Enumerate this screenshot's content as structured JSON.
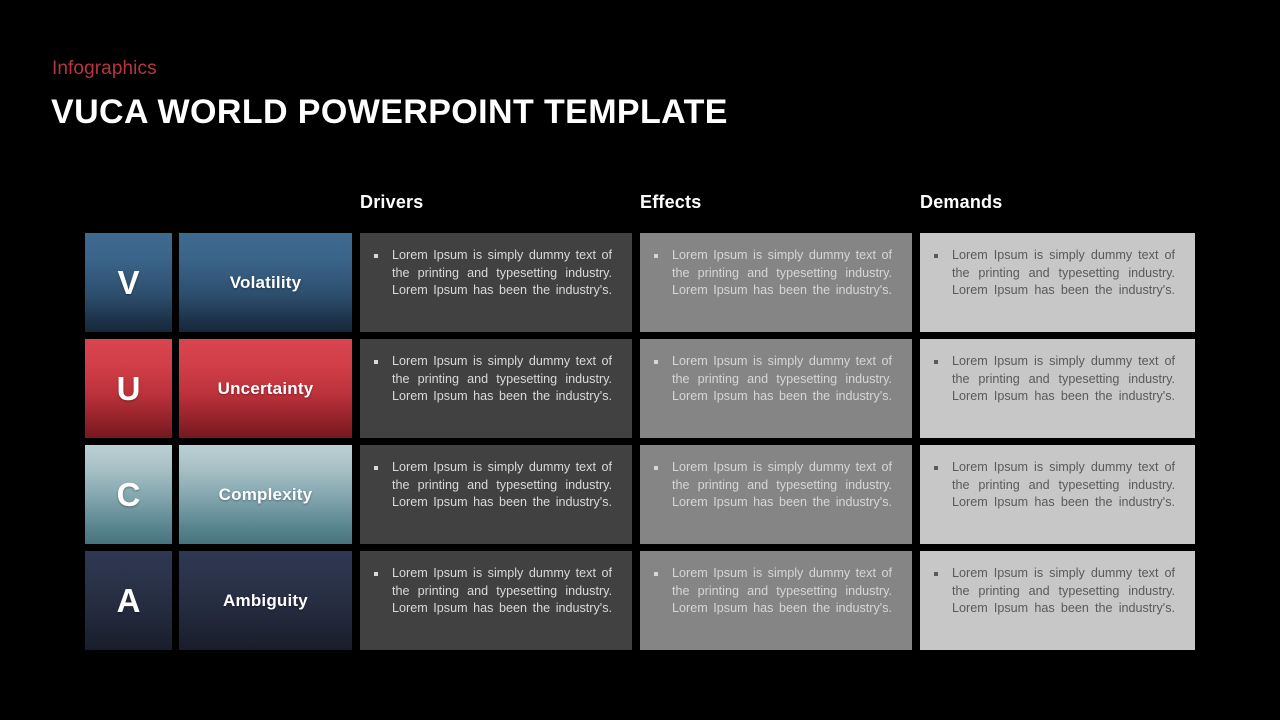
{
  "slide": {
    "eyebrow": "Infographics",
    "title": "VUCA WORLD POWERPOINT TEMPLATE",
    "background_color": "#000000",
    "eyebrow_color": "#b8353f",
    "title_color": "#ffffff"
  },
  "columns": [
    {
      "id": "drivers",
      "label": "Drivers",
      "panel_bg": "#414141",
      "text_color": "#d9d9d9"
    },
    {
      "id": "effects",
      "label": "Effects",
      "panel_bg": "#858585",
      "text_color": "#d6d6d6"
    },
    {
      "id": "demands",
      "label": "Demands",
      "panel_bg": "#c7c7c7",
      "text_color": "#5a5a5a"
    }
  ],
  "body_text": "Lorem Ipsum is simply dummy text of the printing and typesetting industry. Lorem Ipsum has been the industry's.",
  "bullet_icon": "square-bullet-icon",
  "rows": [
    {
      "letter": "V",
      "name": "Volatility",
      "accent_top": "#3f6a90",
      "accent_bottom": "#16273a",
      "cells": {
        "drivers": "Lorem Ipsum is simply dummy text of the printing and typesetting industry. Lorem Ipsum has been the industry's.",
        "effects": "Lorem Ipsum is simply dummy text of the printing and typesetting industry. Lorem Ipsum has been the industry's.",
        "demands": "Lorem Ipsum is simply dummy text of the printing and typesetting industry. Lorem Ipsum has been the industry's."
      }
    },
    {
      "letter": "U",
      "name": "Uncertainty",
      "accent_top": "#d9454e",
      "accent_bottom": "#751820",
      "cells": {
        "drivers": "Lorem Ipsum is simply dummy text of the printing and typesetting industry. Lorem Ipsum has been the industry's.",
        "effects": "Lorem Ipsum is simply dummy text of the printing and typesetting industry. Lorem Ipsum has been the industry's.",
        "demands": "Lorem Ipsum is simply dummy text of the printing and typesetting industry. Lorem Ipsum has been the industry's."
      }
    },
    {
      "letter": "C",
      "name": "Complexity",
      "accent_top": "#bcd0d4",
      "accent_bottom": "#46737d",
      "cells": {
        "drivers": "Lorem Ipsum is simply dummy text of the printing and typesetting industry. Lorem Ipsum has been the industry's.",
        "effects": "Lorem Ipsum is simply dummy text of the printing and typesetting industry. Lorem Ipsum has been the industry's.",
        "demands": "Lorem Ipsum is simply dummy text of the printing and typesetting industry. Lorem Ipsum has been the industry's."
      }
    },
    {
      "letter": "A",
      "name": "Ambiguity",
      "accent_top": "#2e3853",
      "accent_bottom": "#191d2b",
      "cells": {
        "drivers": "Lorem Ipsum is simply dummy text of the printing and typesetting industry. Lorem Ipsum has been the industry's.",
        "effects": "Lorem Ipsum is simply dummy text of the printing and typesetting industry. Lorem Ipsum has been the industry's.",
        "demands": "Lorem Ipsum is simply dummy text of the printing and typesetting industry. Lorem Ipsum has been the industry's."
      }
    }
  ]
}
